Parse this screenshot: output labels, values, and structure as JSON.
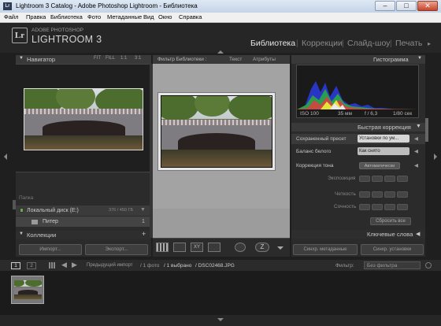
{
  "window": {
    "title": "Lightroom 3 Catalog - Adobe Photoshop Lightroom - Библиотека",
    "icon_text": "Lr",
    "min": "–",
    "max": "□",
    "close": "✕"
  },
  "menu": [
    "Файл",
    "Правка",
    "Библиотека",
    "Фото",
    "Метаданные",
    "Вид",
    "Окно",
    "Справка"
  ],
  "logo": {
    "icon": "Lr",
    "line1": "ADOBE PHOTOSHOP",
    "line2": "LIGHTROOM 3"
  },
  "modules": {
    "library": "Библиотека",
    "develop": "Коррекции",
    "slideshow": "Слайд-шоу",
    "print": "Печать",
    "sep": "|"
  },
  "left": {
    "navigator": {
      "title": "Навигатор",
      "fit": "FIT",
      "fill": "FILL",
      "z1": "1:1",
      "z2": "3:1"
    },
    "catalog_partial": "Папка",
    "disk": {
      "name": "Локальный диск (E:)",
      "size": "376 / 450 ГБ"
    },
    "folder": {
      "name": "Питер",
      "count": "1"
    },
    "collections": "Коллекции",
    "import": "Импорт...",
    "export": "Экспорт..."
  },
  "center": {
    "filter_title": "Фильтр Библиотеки :",
    "tabs": [
      "Текст",
      "Атрибуты"
    ]
  },
  "right": {
    "histogram_title": "Гистограмма",
    "exif": {
      "iso": "ISO 100",
      "focal": "35 мм",
      "fstop": "f / 6,3",
      "shutter": "1/80 сек"
    },
    "quick_dev_title": "Быстрая коррекция",
    "saved_preset": "Сохраненный пресет",
    "preset_value": "Установки по ум...",
    "wb": "Баланс белого",
    "wb_value": "Как снято",
    "tone": "Коррекция тона",
    "auto": "Автоматически",
    "exposure": "Экспозиция",
    "clarity": "Четкость",
    "vibrance": "Сочность",
    "reset": "Сбросить все",
    "keywords": "Ключевые слова",
    "sync_meta": "Синхр. метаданные",
    "sync_settings": "Синхр. установки"
  },
  "bottom": {
    "page1": "1",
    "page2": "2",
    "prev_import": "Предыдущий импорт",
    "count": "/ 1 фото",
    "selected": "/ 1 выбрано",
    "file": "/ DSC02468.JPG",
    "filter_label": "Фильтр:",
    "filter_value": "Без фильтра"
  },
  "colors": {
    "accent": "#e6e6e6",
    "panel": "#2b2b2b"
  }
}
